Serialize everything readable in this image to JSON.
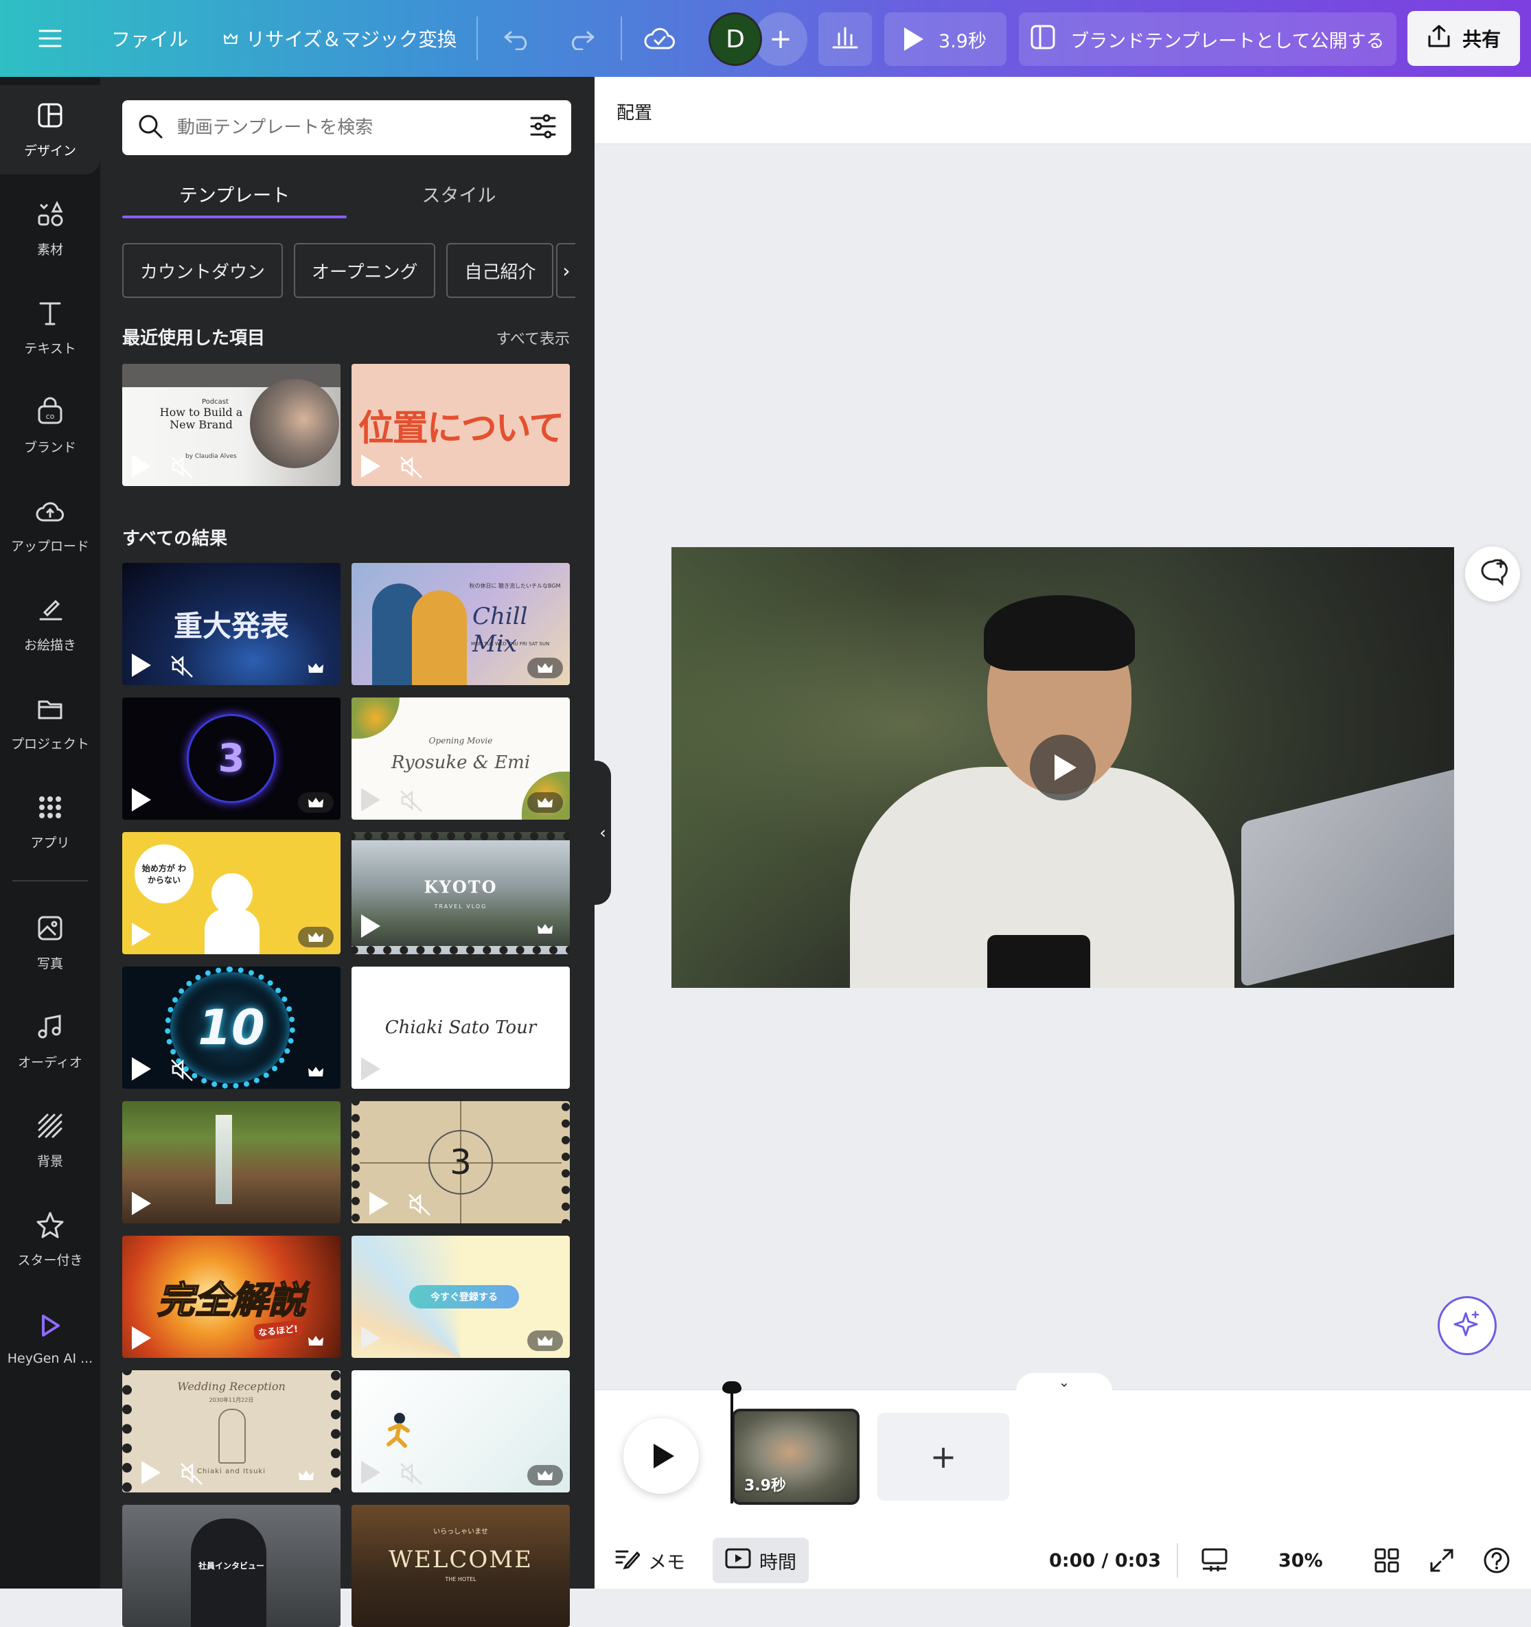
{
  "topbar": {
    "file_label": "ファイル",
    "resize_label": "リサイズ＆マジック変換",
    "avatar_initial": "D",
    "duration_label": "3.9秒",
    "brand_template_label": "ブランドテンプレートとして公開する",
    "share_label": "共有"
  },
  "rail": {
    "items": [
      {
        "label": "デザイン",
        "icon": "layout-icon"
      },
      {
        "label": "素材",
        "icon": "shapes-icon"
      },
      {
        "label": "テキスト",
        "icon": "text-icon"
      },
      {
        "label": "ブランド",
        "icon": "brand-icon"
      },
      {
        "label": "アップロード",
        "icon": "cloud-upload-icon"
      },
      {
        "label": "お絵描き",
        "icon": "draw-icon"
      },
      {
        "label": "プロジェクト",
        "icon": "folder-icon"
      },
      {
        "label": "アプリ",
        "icon": "apps-grid-icon"
      },
      {
        "label": "写真",
        "icon": "photo-icon"
      },
      {
        "label": "オーディオ",
        "icon": "music-icon"
      },
      {
        "label": "背景",
        "icon": "background-icon"
      },
      {
        "label": "スター付き",
        "icon": "star-icon"
      },
      {
        "label": "HeyGen AI ...",
        "icon": "heygen-icon"
      }
    ]
  },
  "panel": {
    "search_placeholder": "動画テンプレートを検索",
    "tabs": [
      "テンプレート",
      "スタイル"
    ],
    "chips": [
      "カウントダウン",
      "オープニング",
      "自己紹介"
    ],
    "recent_title": "最近使用した項目",
    "see_all": "すべて表示",
    "all_results_title": "すべての結果",
    "recent": [
      {
        "text_small": "Podcast",
        "text": "How to Build a New Brand",
        "text_by": "by Claudia Alves"
      },
      {
        "text": "位置について"
      }
    ],
    "results": [
      {
        "text": "重大発表"
      },
      {
        "text_small": "秋の休日に 聴き流したいチルなBGM",
        "text": "Chill Mix",
        "text_days": "MON TUE WED THU FRI SAT SUN"
      },
      {
        "text": "3"
      },
      {
        "text_small": "Opening Movie",
        "text": "Ryosuke & Emi"
      },
      {
        "text": "始め方が わからない"
      },
      {
        "text": "KYOTO",
        "text_small": "TRAVEL VLOG"
      },
      {
        "text": "10"
      },
      {
        "text": "Chiaki Sato Tour"
      },
      {
        "text": ""
      },
      {
        "text": "3"
      },
      {
        "text": "完全解説",
        "text_small": "なるほど!"
      },
      {
        "text": "今すぐ登録する"
      },
      {
        "text_small": "Wedding Reception",
        "text_date": "2030年11月22日",
        "text": "Chiaki and Itsuki"
      },
      {
        "text": ""
      },
      {
        "text": "社員インタビュー"
      },
      {
        "text_small": "いらっしゃいませ",
        "text": "WELCOME",
        "text_sub": "THE HOTEL"
      }
    ]
  },
  "canvas": {
    "page_label": "配置"
  },
  "timeline": {
    "clip_duration": "3.9秒",
    "add_label": "+"
  },
  "bottom_bar": {
    "notes_label": "メモ",
    "time_label": "時間",
    "timecode": "0:00 / 0:03",
    "zoom": "30%"
  },
  "colors": {
    "accent": "#8b5cf6",
    "panel_bg": "#252627",
    "rail_bg": "#18191b"
  }
}
